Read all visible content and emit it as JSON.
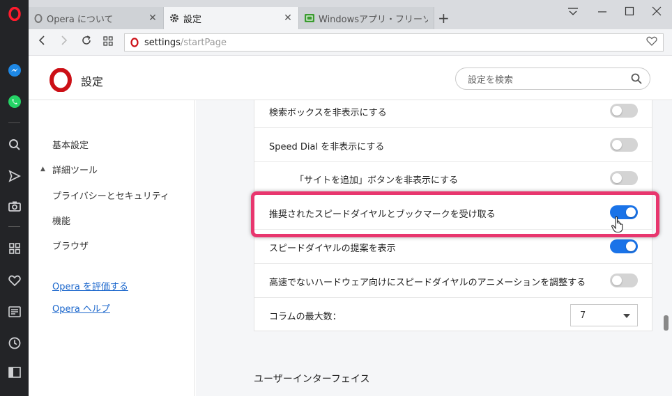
{
  "tabs": [
    {
      "title": "Opera について",
      "icon": "opera-icon"
    },
    {
      "title": "設定",
      "icon": "gear-icon",
      "active": true
    },
    {
      "title": "Windowsアプリ・フリーソフトの",
      "icon": "site-icon"
    }
  ],
  "address": {
    "host": "settings",
    "path": "/startPage"
  },
  "header": {
    "title": "設定",
    "search_placeholder": "設定を検索"
  },
  "nav": {
    "items": [
      {
        "label": "基本設定"
      },
      {
        "label": "詳細ツール"
      },
      {
        "label": "プライバシーとセキュリティ"
      },
      {
        "label": "機能"
      },
      {
        "label": "ブラウザ"
      }
    ],
    "links": [
      {
        "label": "Opera を評価する"
      },
      {
        "label": "Opera ヘルプ"
      }
    ]
  },
  "settings": {
    "rows": [
      {
        "label": "検索ボックスを非表示にする",
        "on": false
      },
      {
        "label": "Speed Dial を非表示にする",
        "on": false
      },
      {
        "label": "「サイトを追加」ボタンを非表示にする",
        "on": false
      },
      {
        "label": "推奨されたスピードダイヤルとブックマークを受け取る",
        "on": true
      },
      {
        "label": "スピードダイヤルの提案を表示",
        "on": true
      },
      {
        "label": "高速でないハードウェア向けにスピードダイヤルのアニメーションを調整する",
        "on": false
      },
      {
        "label": "コラムの最大数："
      }
    ],
    "max_columns": "7"
  },
  "section": {
    "title": "ユーザーインターフェイス"
  },
  "colors": {
    "accent": "#1a73e8",
    "highlight": "#e8366e",
    "sidebar": "#232427",
    "opera_red": "#cc0f16"
  }
}
